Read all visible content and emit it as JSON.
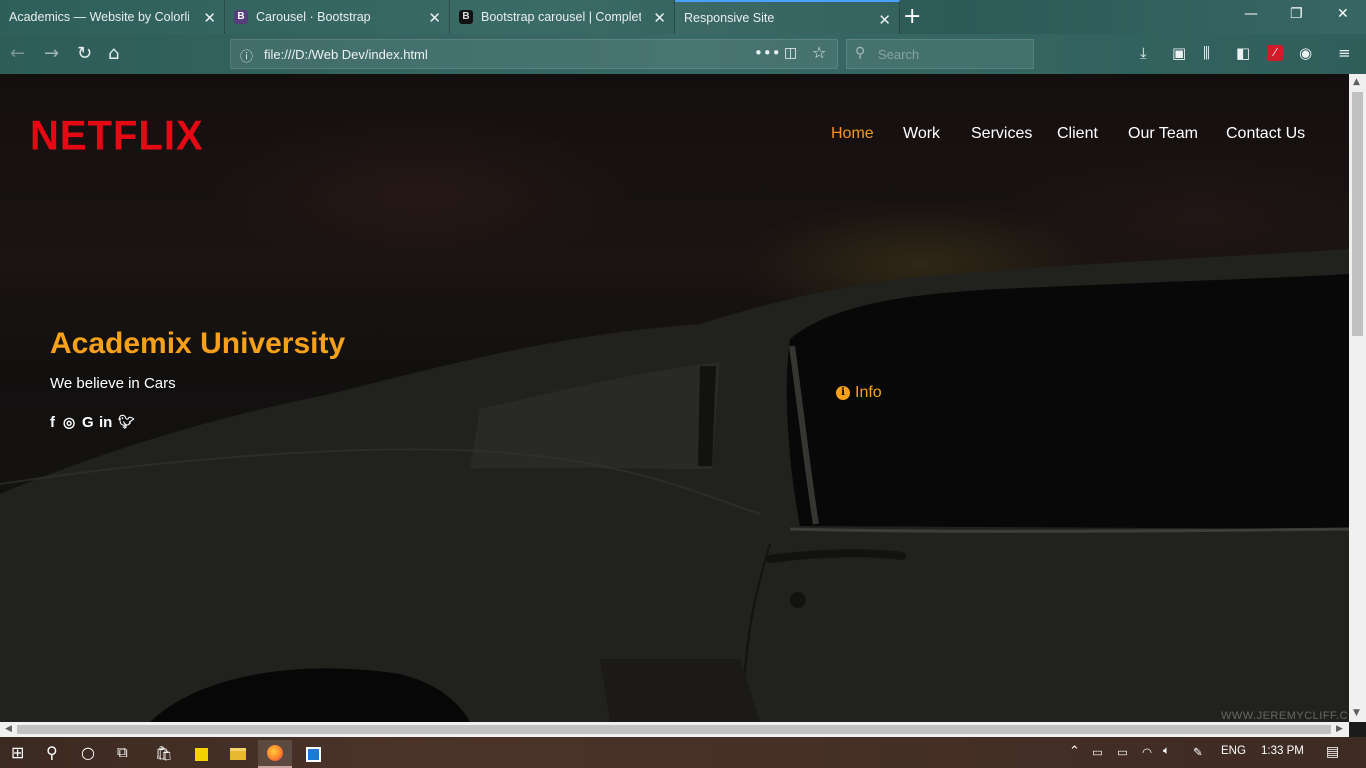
{
  "browser": {
    "tabs": [
      {
        "title": "Academics — Website by Colorlib",
        "active": false
      },
      {
        "title": "Carousel · Bootstrap",
        "active": false,
        "favicon": "B"
      },
      {
        "title": "Bootstrap carousel | Complete",
        "active": false,
        "favicon": "B"
      },
      {
        "title": "Responsive Site",
        "active": true
      }
    ],
    "url": "file:///D:/Web Dev/index.html",
    "search_placeholder": "Search"
  },
  "site": {
    "logo": "NETFLIX",
    "nav": [
      "Home",
      "Work",
      "Services",
      "Client",
      "Our Team",
      "Contact Us"
    ],
    "active_nav": "Home",
    "hero_title": "Academix University",
    "hero_subtitle": "We believe in Cars",
    "social_icons": [
      "facebook-icon",
      "instagram-icon",
      "google-icon",
      "linkedin-icon",
      "twitter-icon"
    ],
    "info_label": "Info",
    "watermark": "WWW.JEREMYCLIFF.C"
  },
  "taskbar": {
    "language": "ENG",
    "time": "1:33 PM"
  },
  "colors": {
    "accent": "#f7a11a",
    "logo_red": "#e50914",
    "chrome_teal": "#2f5f5a"
  }
}
